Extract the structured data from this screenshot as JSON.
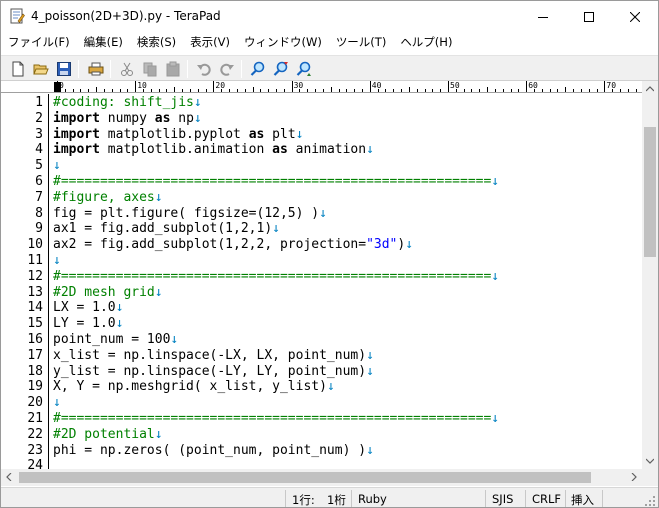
{
  "window": {
    "title": "4_poisson(2D+3D).py - TeraPad"
  },
  "menu": [
    {
      "label": "ファイル(F)"
    },
    {
      "label": "編集(E)"
    },
    {
      "label": "検索(S)"
    },
    {
      "label": "表示(V)"
    },
    {
      "label": "ウィンドウ(W)"
    },
    {
      "label": "ツール(T)"
    },
    {
      "label": "ヘルプ(H)"
    }
  ],
  "toolbar": {
    "icons": [
      "new-file-icon",
      "open-folder-icon",
      "save-icon",
      "print-icon",
      "cut-icon",
      "copy-icon",
      "paste-icon",
      "undo-icon",
      "redo-icon",
      "find-icon",
      "find-next-icon",
      "find-previous-icon"
    ]
  },
  "ruler": {
    "labels": [
      "0",
      "10",
      "20",
      "30",
      "40",
      "50",
      "60",
      "70"
    ]
  },
  "editor": {
    "eol_marker": "↓",
    "lines": [
      {
        "num": "1",
        "parts": [
          {
            "t": "#coding: shift_jis",
            "c": "cm"
          }
        ]
      },
      {
        "num": "2",
        "parts": [
          {
            "t": "import",
            "c": "kw"
          },
          {
            "t": " numpy ",
            "c": ""
          },
          {
            "t": "as",
            "c": "kw"
          },
          {
            "t": " np",
            "c": ""
          }
        ]
      },
      {
        "num": "3",
        "parts": [
          {
            "t": "import",
            "c": "kw"
          },
          {
            "t": " matplotlib.pyplot ",
            "c": ""
          },
          {
            "t": "as",
            "c": "kw"
          },
          {
            "t": " plt",
            "c": ""
          }
        ]
      },
      {
        "num": "4",
        "parts": [
          {
            "t": "import",
            "c": "kw"
          },
          {
            "t": " matplotlib.animation ",
            "c": ""
          },
          {
            "t": "as",
            "c": "kw"
          },
          {
            "t": " animation",
            "c": ""
          }
        ]
      },
      {
        "num": "5",
        "parts": []
      },
      {
        "num": "6",
        "parts": [
          {
            "t": "#=======================================================",
            "c": "cm"
          }
        ]
      },
      {
        "num": "7",
        "parts": [
          {
            "t": "#figure, axes",
            "c": "cm"
          }
        ]
      },
      {
        "num": "8",
        "parts": [
          {
            "t": "fig = plt.figure( figsize=(12,5) )",
            "c": ""
          }
        ]
      },
      {
        "num": "9",
        "parts": [
          {
            "t": "ax1 = fig.add_subplot(1,2,1)",
            "c": ""
          }
        ]
      },
      {
        "num": "10",
        "parts": [
          {
            "t": "ax2 = fig.add_subplot(1,2,2, projection=",
            "c": ""
          },
          {
            "t": "\"3d\"",
            "c": "str"
          },
          {
            "t": ")",
            "c": ""
          }
        ]
      },
      {
        "num": "11",
        "parts": []
      },
      {
        "num": "12",
        "parts": [
          {
            "t": "#=======================================================",
            "c": "cm"
          }
        ]
      },
      {
        "num": "13",
        "parts": [
          {
            "t": "#2D mesh grid",
            "c": "cm"
          }
        ]
      },
      {
        "num": "14",
        "parts": [
          {
            "t": "LX = 1.0",
            "c": ""
          }
        ]
      },
      {
        "num": "15",
        "parts": [
          {
            "t": "LY = 1.0",
            "c": ""
          }
        ]
      },
      {
        "num": "16",
        "parts": [
          {
            "t": "point_num = 100",
            "c": ""
          }
        ]
      },
      {
        "num": "17",
        "parts": [
          {
            "t": "x_list = np.linspace(-LX, LX, point_num)",
            "c": ""
          }
        ]
      },
      {
        "num": "18",
        "parts": [
          {
            "t": "y_list = np.linspace(-LY, LY, point_num)",
            "c": ""
          }
        ]
      },
      {
        "num": "19",
        "parts": [
          {
            "t": "X, Y = np.meshgrid( x_list, y_list)",
            "c": ""
          }
        ]
      },
      {
        "num": "20",
        "parts": []
      },
      {
        "num": "21",
        "parts": [
          {
            "t": "#=======================================================",
            "c": "cm"
          }
        ]
      },
      {
        "num": "22",
        "parts": [
          {
            "t": "#2D potential",
            "c": "cm"
          }
        ]
      },
      {
        "num": "23",
        "parts": [
          {
            "t": "phi = np.zeros( (point_num, point_num) )",
            "c": ""
          }
        ]
      },
      {
        "num": "24",
        "parts": [
          {
            "t": "",
            "c": ""
          }
        ]
      }
    ]
  },
  "statusbar": {
    "line": "1行:",
    "col": "1桁",
    "lang": "Ruby",
    "encoding": "SJIS",
    "newline": "CRLF",
    "mode": "挿入"
  }
}
